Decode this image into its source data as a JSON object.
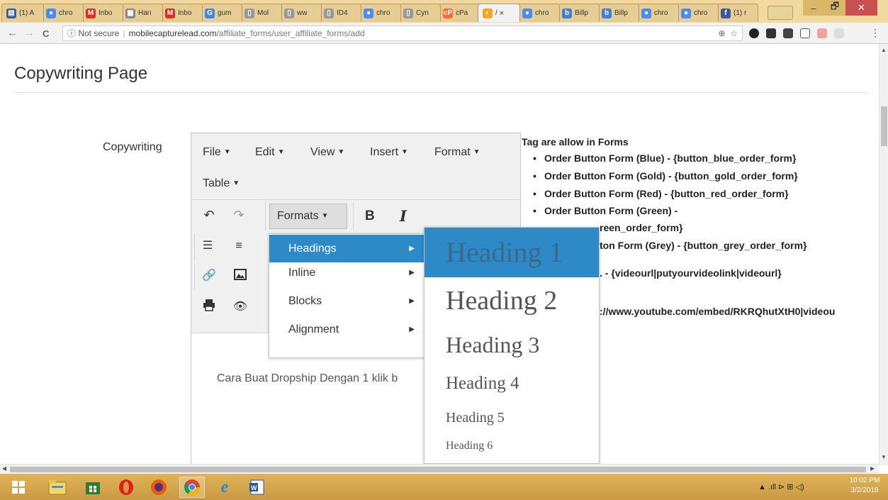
{
  "browser": {
    "tabs": [
      {
        "label": "(1) A",
        "color": "#3b5998",
        "glyph": "▤"
      },
      {
        "label": "chro",
        "color": "#4c8bf5",
        "glyph": "●"
      },
      {
        "label": "Inbo",
        "color": "#d93025",
        "glyph": "M"
      },
      {
        "label": "Harı",
        "color": "#888888",
        "glyph": "▦"
      },
      {
        "label": "Inbo",
        "color": "#d93025",
        "glyph": "M"
      },
      {
        "label": "gum",
        "color": "#4285f4",
        "glyph": "G"
      },
      {
        "label": "Mol",
        "color": "#999999",
        "glyph": "▯"
      },
      {
        "label": "ww",
        "color": "#999999",
        "glyph": "▯"
      },
      {
        "label": "ID4",
        "color": "#999999",
        "glyph": "▯"
      },
      {
        "label": "chro",
        "color": "#4c8bf5",
        "glyph": "●"
      },
      {
        "label": "Cyn",
        "color": "#999999",
        "glyph": "▯"
      },
      {
        "label": "cPa",
        "color": "#ff6c2c",
        "glyph": "cP"
      },
      {
        "label": "/",
        "color": "#f5a623",
        "glyph": "◐",
        "active": true
      },
      {
        "label": "chro",
        "color": "#4c8bf5",
        "glyph": "●"
      },
      {
        "label": "Billp",
        "color": "#3d7fd6",
        "glyph": "b"
      },
      {
        "label": "Billp",
        "color": "#3d7fd6",
        "glyph": "b"
      },
      {
        "label": "chro",
        "color": "#4c8bf5",
        "glyph": "●"
      },
      {
        "label": "chro",
        "color": "#4c8bf5",
        "glyph": "●"
      },
      {
        "label": "(1) r",
        "color": "#3b5998",
        "glyph": "f"
      }
    ],
    "active_close": "×",
    "back": "←",
    "forward": "→",
    "reload": "C",
    "insecure_label": "ⓘ Not secure",
    "url_host": "mobilecapturelead.com",
    "url_path": "/affiliate_forms/user_affiliate_forms/add",
    "zoom_icon": "⊕",
    "star_icon": "☆",
    "menu_icon": "⋮",
    "window": {
      "minimize": "–",
      "maximize": "🗗",
      "close": "✕",
      "profile": "m"
    }
  },
  "page": {
    "title": "Copywriting Page",
    "field_label": "Copywriting"
  },
  "editor": {
    "menus": [
      "File",
      "Edit",
      "View",
      "Insert",
      "Format",
      "Table"
    ],
    "formats_label": "Formats",
    "bold": "B",
    "italic": "I",
    "content": "Cara Buat Dropship Dengan 1 klik b",
    "formats_menu": [
      {
        "label": "Headings",
        "active": true
      },
      {
        "label": "Inline",
        "active": false
      },
      {
        "label": "Blocks",
        "active": false
      },
      {
        "label": "Alignment",
        "active": false
      }
    ],
    "headings_menu": [
      "Heading 1",
      "Heading 2",
      "Heading 3",
      "Heading 4",
      "Heading 5",
      "Heading 6"
    ]
  },
  "tags": {
    "title": "Tag are allow in Forms",
    "items": [
      "Order Button Form (Blue) - {button_blue_order_form}",
      "Order Button Form (Gold) - {button_gold_order_form}",
      "Order Button Form (Red) - {button_red_order_form}",
      "Order Button Form (Green) -",
      "reen_order_form}",
      "ton Form (Grey) - {button_grey_order_form}",
      ". - {videourl|putyourvideolink|videourl}",
      "://www.youtube.com/embed/RKRQhutXtH0|videou"
    ]
  },
  "taskbar": {
    "clock_time": "10:02 PM",
    "clock_date": "3/2/2018",
    "tray": "▲  .ıll  ⊳  ⊞  ◁)"
  },
  "colors": {
    "accent": "#2d8ac7",
    "taskbar": "#d4a64e",
    "tabstrip": "#f1d9a0"
  }
}
